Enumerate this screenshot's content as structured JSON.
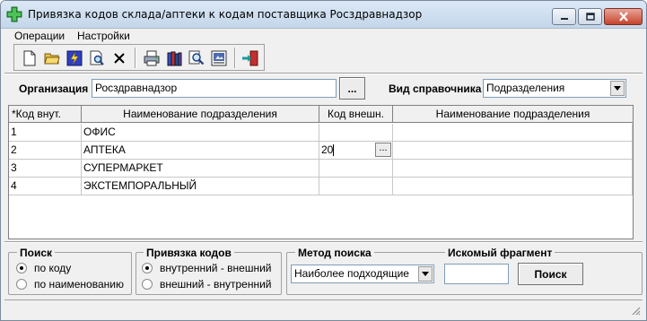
{
  "window": {
    "title": "Привязка кодов склада/аптеки к кодам поставщика Росздравнадзор",
    "app_icon": "green-cross-icon",
    "controls": [
      "minimize-icon",
      "maximize-icon",
      "close-icon"
    ]
  },
  "menu": {
    "items": [
      {
        "label": "Операции"
      },
      {
        "label": "Настройки"
      }
    ]
  },
  "toolbar": {
    "buttons": [
      {
        "icon": "new-document-icon"
      },
      {
        "icon": "open-folder-icon"
      },
      {
        "icon": "lightning-icon"
      },
      {
        "icon": "find-document-icon"
      },
      {
        "icon": "delete-x-icon"
      },
      {
        "icon": "print-icon"
      },
      {
        "icon": "books-icon"
      },
      {
        "icon": "magnifier-icon"
      },
      {
        "icon": "export-icon"
      },
      {
        "icon": "exit-door-icon"
      }
    ]
  },
  "form": {
    "organization_label": "Организация",
    "organization_value": "Росздравнадзор",
    "browse_button": "...",
    "directory_label": "Вид справочника",
    "directory_value": "Подразделения"
  },
  "table": {
    "columns": [
      "*Код внут.",
      "Наименование подразделения",
      "Код внешн.",
      "Наименование подразделения"
    ],
    "rows": [
      {
        "code_in": "1",
        "name_in": "ОФИС",
        "code_out": "",
        "name_out": ""
      },
      {
        "code_in": "2",
        "name_in": "АПТЕКА",
        "code_out": "20",
        "name_out": ""
      },
      {
        "code_in": "3",
        "name_in": "СУПЕРМАРКЕТ",
        "code_out": "",
        "name_out": ""
      },
      {
        "code_in": "4",
        "name_in": "ЭКСТЕМПОРАЛЬНЫЙ",
        "code_out": "",
        "name_out": ""
      }
    ],
    "edit_button": "..."
  },
  "search_group": {
    "title": "Поиск",
    "options": [
      {
        "label": "по коду",
        "selected": true
      },
      {
        "label": "по наименованию",
        "selected": false
      }
    ]
  },
  "binding_group": {
    "title": "Привязка кодов",
    "options": [
      {
        "label": "внутренний - внешний",
        "selected": true
      },
      {
        "label": "внешний - внутренний",
        "selected": false
      }
    ]
  },
  "method_group": {
    "title": "Метод поиска",
    "value": "Наиболее подходящие"
  },
  "fragment_group": {
    "title": "Искомый  фрагмент",
    "value": "",
    "search_button": "Поиск"
  }
}
